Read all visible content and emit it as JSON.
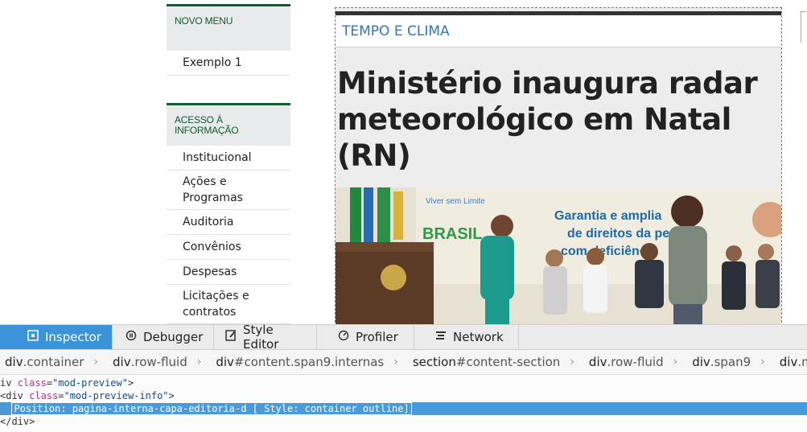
{
  "sidebar": {
    "menu1": {
      "title": "NOVO MENU",
      "items": [
        "Exemplo 1"
      ]
    },
    "menu2": {
      "title": "ACESSO À INFORMAÇÃO",
      "items": [
        "Institucional",
        "Ações e Programas",
        "Auditoria",
        "Convênios",
        "Despesas",
        "Licitações e contratos"
      ]
    }
  },
  "article": {
    "kicker": "TEMPO E CLIMA",
    "headline": "Ministério inaugura radar meteorológico em Natal (RN)",
    "photo_text": {
      "logo_top": "Viver sem Limite",
      "logo_brand": "BRASIL",
      "banner_line1": "Garantia e amplia",
      "banner_line2": "de direitos da pes",
      "banner_line3": "com deficiência"
    }
  },
  "devtools": {
    "tabs": [
      {
        "label": "Inspector",
        "icon": "inspector-icon"
      },
      {
        "label": "Debugger",
        "icon": "debugger-icon"
      },
      {
        "label": "Style Editor",
        "icon": "style-editor-icon"
      },
      {
        "label": "Profiler",
        "icon": "profiler-icon"
      },
      {
        "label": "Network",
        "icon": "network-icon"
      }
    ],
    "breadcrumbs": [
      {
        "tag": "div",
        "rest": ".container"
      },
      {
        "tag": "div",
        "rest": ".row-fluid"
      },
      {
        "tag": "div",
        "rest": "#content.span9.internas"
      },
      {
        "tag": "section",
        "rest": "#content-section"
      },
      {
        "tag": "div",
        "rest": ".row-fluid"
      },
      {
        "tag": "div",
        "rest": ".span9"
      },
      {
        "tag": "div",
        "rest": ".mod-preview"
      }
    ],
    "code": {
      "line1_tag": "iv ",
      "line1_attr": "class",
      "line1_val": "\"mod-preview\"",
      "line2_tag": "<div ",
      "line2_attr": "class",
      "line2_val": "\"mod-preview-info\"",
      "line3": "Position: pagina-interna-capa-editoria-d [ Style: container outline]",
      "line4": "</div>"
    }
  },
  "colors": {
    "accent_green": "#0e5c2f",
    "kicker_blue": "#3674b4",
    "devtools_active": "#3b94d9"
  }
}
